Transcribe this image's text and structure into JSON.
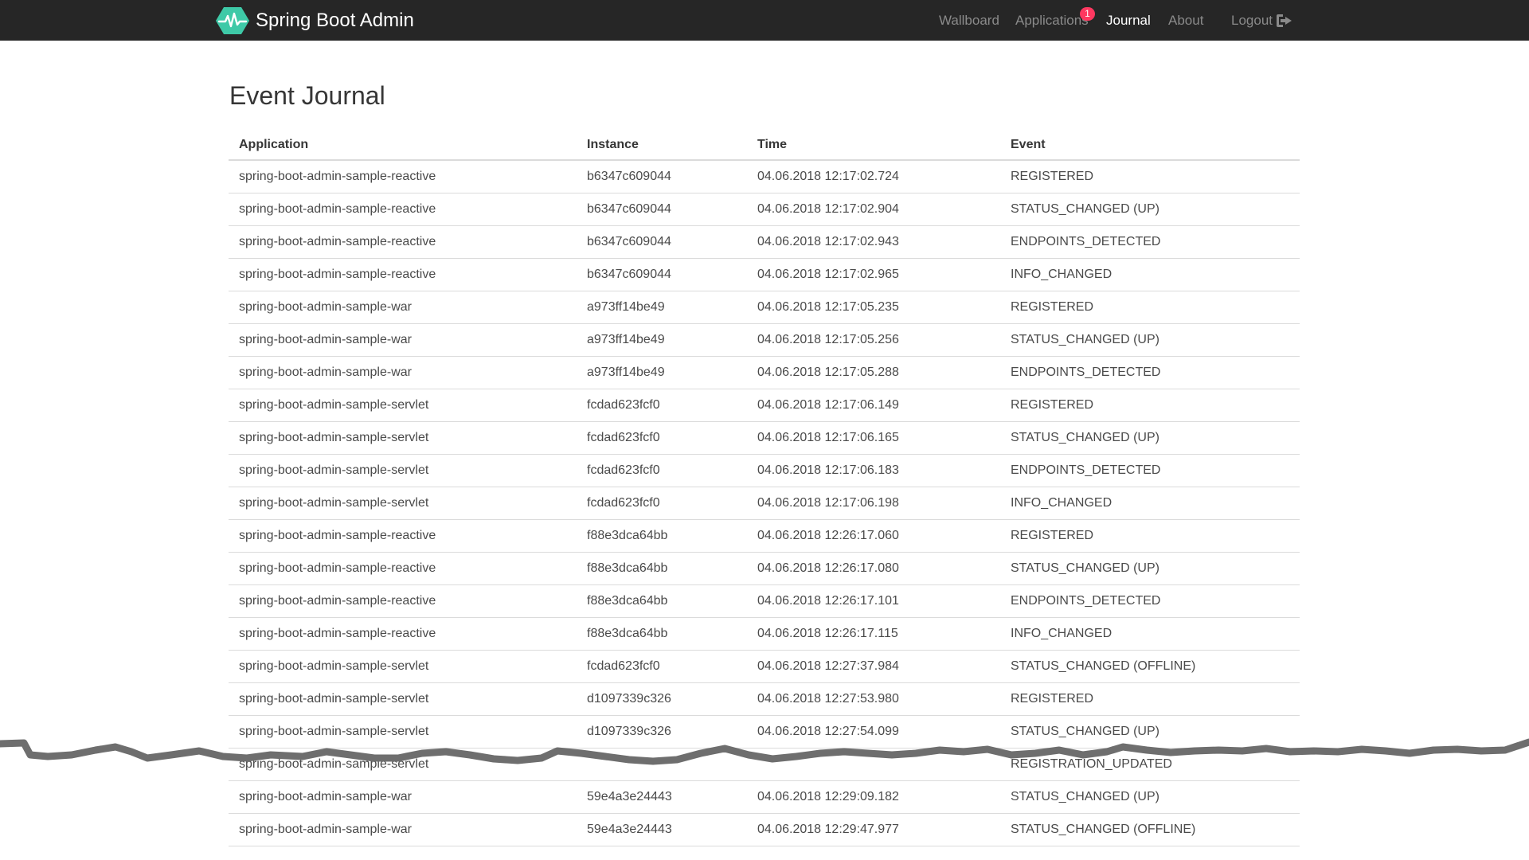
{
  "navbar": {
    "brand_name": "Spring Boot Admin",
    "items": {
      "wallboard": "Wallboard",
      "applications": "Applications",
      "applications_badge": "1",
      "journal": "Journal",
      "about": "About",
      "logout": "Logout"
    },
    "icons": {
      "brand": "heartbeat-logo-icon",
      "logout": "sign-out-icon"
    }
  },
  "page": {
    "title": "Event Journal"
  },
  "table": {
    "columns": [
      "Application",
      "Instance",
      "Time",
      "Event"
    ],
    "rows": [
      [
        "spring-boot-admin-sample-reactive",
        "b6347c609044",
        "04.06.2018 12:17:02.724",
        "REGISTERED"
      ],
      [
        "spring-boot-admin-sample-reactive",
        "b6347c609044",
        "04.06.2018 12:17:02.904",
        "STATUS_CHANGED (UP)"
      ],
      [
        "spring-boot-admin-sample-reactive",
        "b6347c609044",
        "04.06.2018 12:17:02.943",
        "ENDPOINTS_DETECTED"
      ],
      [
        "spring-boot-admin-sample-reactive",
        "b6347c609044",
        "04.06.2018 12:17:02.965",
        "INFO_CHANGED"
      ],
      [
        "spring-boot-admin-sample-war",
        "a973ff14be49",
        "04.06.2018 12:17:05.235",
        "REGISTERED"
      ],
      [
        "spring-boot-admin-sample-war",
        "a973ff14be49",
        "04.06.2018 12:17:05.256",
        "STATUS_CHANGED (UP)"
      ],
      [
        "spring-boot-admin-sample-war",
        "a973ff14be49",
        "04.06.2018 12:17:05.288",
        "ENDPOINTS_DETECTED"
      ],
      [
        "spring-boot-admin-sample-servlet",
        "fcdad623fcf0",
        "04.06.2018 12:17:06.149",
        "REGISTERED"
      ],
      [
        "spring-boot-admin-sample-servlet",
        "fcdad623fcf0",
        "04.06.2018 12:17:06.165",
        "STATUS_CHANGED (UP)"
      ],
      [
        "spring-boot-admin-sample-servlet",
        "fcdad623fcf0",
        "04.06.2018 12:17:06.183",
        "ENDPOINTS_DETECTED"
      ],
      [
        "spring-boot-admin-sample-servlet",
        "fcdad623fcf0",
        "04.06.2018 12:17:06.198",
        "INFO_CHANGED"
      ],
      [
        "spring-boot-admin-sample-reactive",
        "f88e3dca64bb",
        "04.06.2018 12:26:17.060",
        "REGISTERED"
      ],
      [
        "spring-boot-admin-sample-reactive",
        "f88e3dca64bb",
        "04.06.2018 12:26:17.080",
        "STATUS_CHANGED (UP)"
      ],
      [
        "spring-boot-admin-sample-reactive",
        "f88e3dca64bb",
        "04.06.2018 12:26:17.101",
        "ENDPOINTS_DETECTED"
      ],
      [
        "spring-boot-admin-sample-reactive",
        "f88e3dca64bb",
        "04.06.2018 12:26:17.115",
        "INFO_CHANGED"
      ],
      [
        "spring-boot-admin-sample-servlet",
        "fcdad623fcf0",
        "04.06.2018 12:27:37.984",
        "STATUS_CHANGED (OFFLINE)"
      ],
      [
        "spring-boot-admin-sample-servlet",
        "d1097339c326",
        "04.06.2018 12:27:53.980",
        "REGISTERED"
      ],
      [
        "spring-boot-admin-sample-servlet",
        "d1097339c326",
        "04.06.2018 12:27:54.099",
        "STATUS_CHANGED (UP)"
      ],
      [
        "spring-boot-admin-sample-servlet",
        "",
        "",
        "REGISTRATION_UPDATED"
      ],
      [
        "spring-boot-admin-sample-war",
        "59e4a3e24443",
        "04.06.2018 12:29:09.182",
        "STATUS_CHANGED (UP)"
      ],
      [
        "spring-boot-admin-sample-war",
        "59e4a3e24443",
        "04.06.2018 12:29:47.977",
        "STATUS_CHANGED (OFFLINE)"
      ]
    ]
  },
  "colors": {
    "navbar_bg": "#262626",
    "brand_logo": "#3ec9a7",
    "badge": "#ff3860",
    "tear_line": "#6e6e6e"
  }
}
